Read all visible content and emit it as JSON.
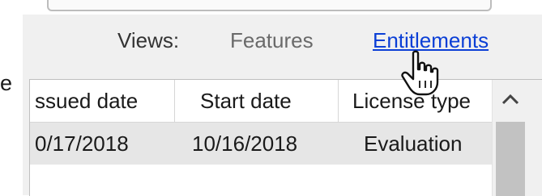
{
  "left_edge": {
    "text": "e"
  },
  "views": {
    "label": "Views:",
    "items": [
      {
        "label": "Features",
        "active": false
      },
      {
        "label": "Entitlements",
        "active": true
      }
    ]
  },
  "grid": {
    "columns": [
      "ssued date",
      "Start date",
      "License type"
    ],
    "rows": [
      [
        "0/17/2018",
        "10/16/2018",
        "Evaluation"
      ]
    ]
  },
  "icons": {
    "scroll_up": "chevron-up-icon",
    "cursor": "hand-pointer-icon"
  },
  "colors": {
    "link": "#0b3fd6",
    "inactive_view": "#6a6a6a",
    "selected_row": "#e6e6e6",
    "scroll_thumb": "#c2c2c2"
  }
}
